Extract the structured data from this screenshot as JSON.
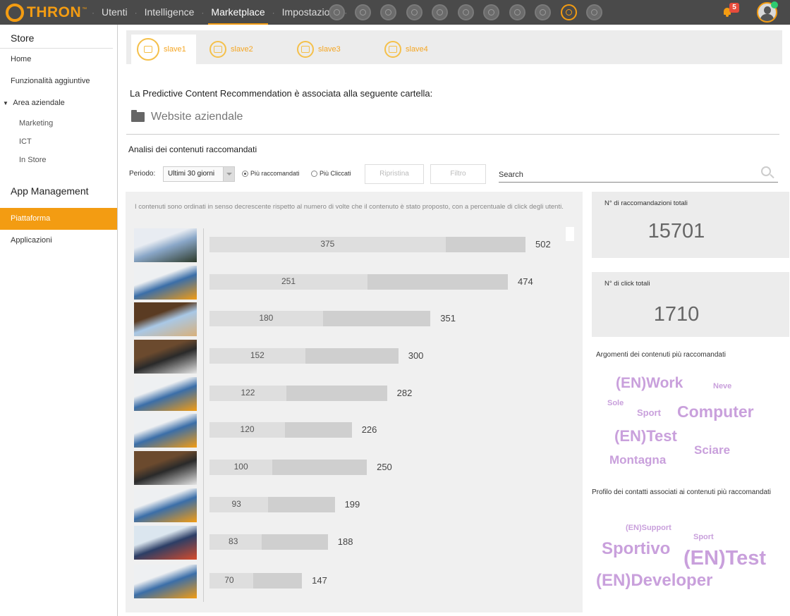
{
  "brand": {
    "name": "THRON",
    "tm": "™",
    "accent": "#f39c12"
  },
  "nav": {
    "items": [
      {
        "label": "Utenti"
      },
      {
        "label": "Intelligence"
      },
      {
        "label": "Marketplace",
        "active": true
      },
      {
        "label": "Impostazioni"
      }
    ]
  },
  "app_icons": [
    "app-icon-1",
    "app-icon-2",
    "app-icon-3",
    "app-icon-4",
    "app-icon-5",
    "app-icon-6",
    "app-icon-7",
    "app-icon-8",
    "app-icon-9",
    "app-icon-10",
    "app-icon-11"
  ],
  "notifications": {
    "count": "5"
  },
  "sidebar": {
    "store_heading": "Store",
    "home": "Home",
    "extras": "Funzionalità aggiuntive",
    "area": "Area aziendale",
    "area_items": [
      "Marketing",
      "ICT",
      "In Store"
    ],
    "app_heading": "App Management",
    "platform": "Piattaforma",
    "apps": "Applicazioni"
  },
  "tabs": [
    {
      "label": "slave1",
      "active": true
    },
    {
      "label": "slave2"
    },
    {
      "label": "slave3"
    },
    {
      "label": "slave4"
    }
  ],
  "association_text": "La Predictive Content Recommendation è associata alla seguente cartella:",
  "folder_name": "Website aziendale",
  "analysis_title": "Analisi dei contenuti raccomandati",
  "filters": {
    "period_label": "Periodo:",
    "period_value": "Ultimi 30 giorni",
    "radio_recommended": "Più raccomandati",
    "radio_clicked": "Più Cliccati",
    "reset_label": "Ripristina",
    "filter_label": "Filtro",
    "search_placeholder": "Search"
  },
  "results_note": "I contenuti sono ordinati in senso decrescente rispetto al numero di volte che il contenuto è stato proposto, con a percentuale di click degli utenti.",
  "rows": [
    {
      "thumb": "snow",
      "clicks": 375,
      "total": 502
    },
    {
      "thumb": "laptop",
      "clicks": 251,
      "total": 474
    },
    {
      "thumb": "cafe",
      "clicks": 180,
      "total": 351
    },
    {
      "thumb": "desk",
      "clicks": 152,
      "total": 300
    },
    {
      "thumb": "laptop",
      "clicks": 122,
      "total": 282
    },
    {
      "thumb": "laptop",
      "clicks": 120,
      "total": 226
    },
    {
      "thumb": "desk",
      "clicks": 100,
      "total": 250
    },
    {
      "thumb": "laptop",
      "clicks": 93,
      "total": 199
    },
    {
      "thumb": "goggles",
      "clicks": 83,
      "total": 188
    },
    {
      "thumb": "laptop",
      "clicks": 70,
      "total": 147
    }
  ],
  "stats": {
    "recommendations_label": "N° di raccomandazioni totali",
    "recommendations_value": "15701",
    "clicks_label": "N° di click totali",
    "clicks_value": "1710"
  },
  "topics": {
    "title": "Argomenti dei contenuti più raccomandati",
    "words": [
      "(EN)Work",
      "Neve",
      "Sole",
      "Sport",
      "Computer",
      "(EN)Test",
      "Sciare",
      "Montagna"
    ]
  },
  "profiles": {
    "title": "Profilo dei contatti associati ai contenuti più raccomandati",
    "words": [
      "(EN)Support",
      "Sport",
      "Sportivo",
      "(EN)Test",
      "(EN)Developer"
    ]
  },
  "colors": {
    "cloud": "#c9a0dc",
    "bar_total": "#cfcfcf",
    "bar_click": "#dedede"
  }
}
